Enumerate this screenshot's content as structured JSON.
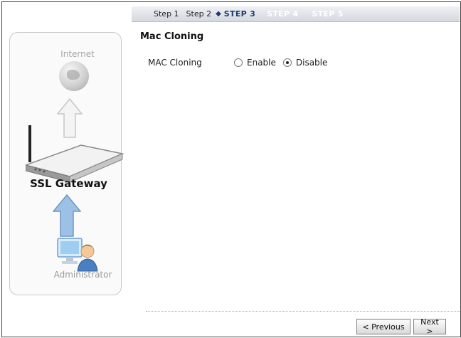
{
  "steps": [
    {
      "label": "Step 1",
      "state": "done"
    },
    {
      "label": "Step 2",
      "state": "done"
    },
    {
      "label": "STEP 3",
      "state": "current"
    },
    {
      "label": "STEP 4",
      "state": "future"
    },
    {
      "label": "STEP 5",
      "state": "future"
    }
  ],
  "diagram": {
    "internet_label": "Internet",
    "gateway_label": "SSL Gateway",
    "admin_label": "Administrator",
    "icons": [
      "globe-icon",
      "arrow-up-icon",
      "router-icon",
      "arrow-up-icon",
      "administrator-icon"
    ]
  },
  "main": {
    "title": "Mac Cloning",
    "field_label": "MAC Cloning",
    "options": [
      {
        "label": "Enable",
        "checked": false
      },
      {
        "label": "Disable",
        "checked": true
      }
    ]
  },
  "buttons": {
    "previous": "< Previous",
    "next": "Next >"
  },
  "colors": {
    "current_step": "#1f3a6b",
    "future_step": "#ffffff",
    "step_bar": "#d4d9df",
    "arrow_blue": "#7fa9d6"
  }
}
